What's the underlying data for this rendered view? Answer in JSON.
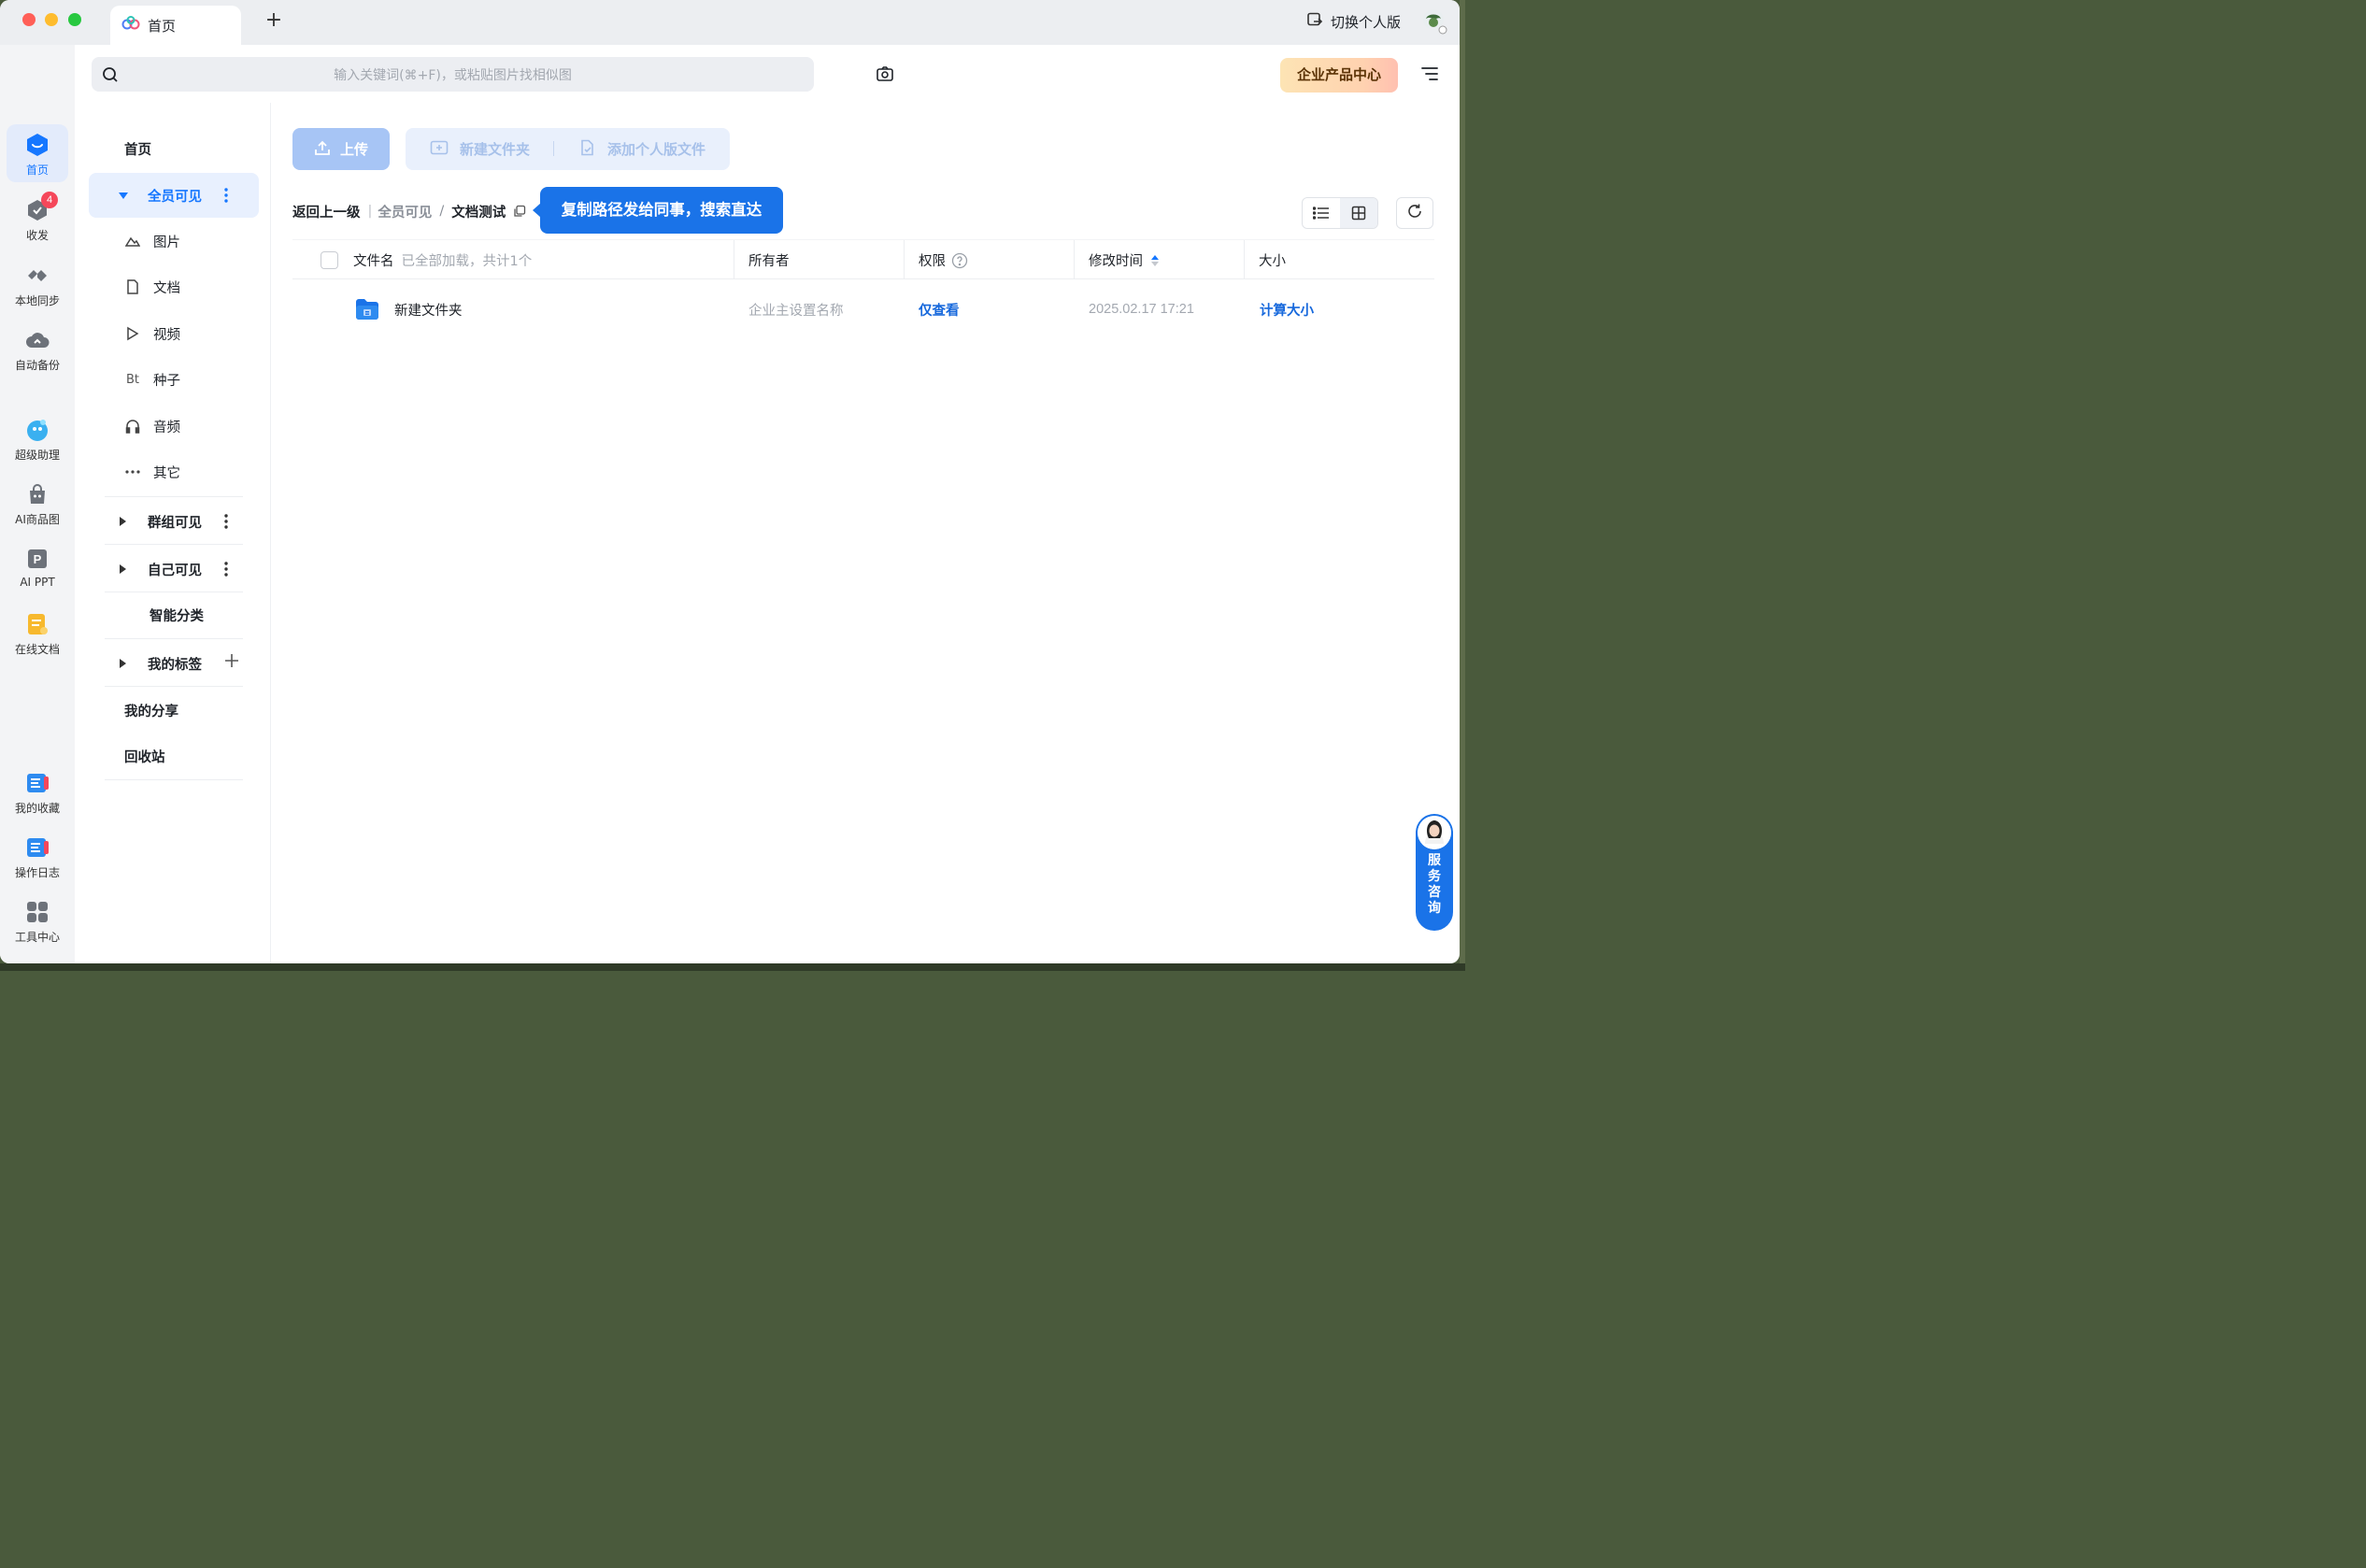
{
  "titlebar": {
    "tab_label": "首页",
    "new_tab": "+",
    "switch_personal": "切换个人版"
  },
  "rail": {
    "items": [
      {
        "label": "首页",
        "icon": "home-icon",
        "active": true
      },
      {
        "label": "收发",
        "icon": "transfer-icon",
        "badge": "4"
      },
      {
        "label": "本地同步",
        "icon": "sync-icon"
      },
      {
        "label": "自动备份",
        "icon": "cloud-backup-icon"
      },
      {
        "label": "超级助理",
        "icon": "assistant-icon"
      },
      {
        "label": "AI商品图",
        "icon": "ai-product-icon"
      },
      {
        "label": "AI PPT",
        "icon": "ppt-icon"
      },
      {
        "label": "在线文档",
        "icon": "online-doc-icon"
      },
      {
        "label": "我的收藏",
        "icon": "favorites-icon"
      },
      {
        "label": "操作日志",
        "icon": "log-icon"
      },
      {
        "label": "工具中心",
        "icon": "tools-icon"
      }
    ]
  },
  "search": {
    "placeholder": "输入关键词(⌘+F)，或粘贴图片找相似图"
  },
  "enterprise_center": "企业产品中心",
  "nav": {
    "home": "首页",
    "all_visible": "全员可见",
    "sub": [
      {
        "label": "图片",
        "icon": "image-icon"
      },
      {
        "label": "文档",
        "icon": "document-icon"
      },
      {
        "label": "视频",
        "icon": "video-icon"
      },
      {
        "label": "种子",
        "icon": "bt-icon",
        "glyph": "Bt"
      },
      {
        "label": "音频",
        "icon": "headphones-icon"
      },
      {
        "label": "其它",
        "icon": "more-icon"
      }
    ],
    "group_visible": "群组可见",
    "self_visible": "自己可见",
    "smart_category": "智能分类",
    "my_tags": "我的标签",
    "my_share": "我的分享",
    "recycle_bin": "回收站"
  },
  "toolbar": {
    "upload": "上传",
    "new_folder": "新建文件夹",
    "add_personal": "添加个人版文件"
  },
  "breadcrumb": {
    "back": "返回上一级",
    "pipe": "|",
    "level1": "全员可见",
    "separator": "/",
    "current": "文档测试",
    "tooltip": "复制路径发给同事，搜索直达"
  },
  "table": {
    "columns": {
      "name": "文件名",
      "name_hint": "已全部加载，共计1个",
      "owner": "所有者",
      "permission": "权限",
      "modified": "修改时间",
      "size": "大小"
    },
    "rows": [
      {
        "name": "新建文件夹",
        "owner": "企业主设置名称",
        "permission": "仅查看",
        "modified": "2025.02.17 17:21",
        "size": "计算大小"
      }
    ]
  },
  "service": {
    "label_chars": [
      "服",
      "务",
      "咨",
      "询"
    ]
  },
  "colors": {
    "accent": "#1677ff",
    "badge": "#f5475a",
    "tooltip_bg": "#1a73e8"
  }
}
